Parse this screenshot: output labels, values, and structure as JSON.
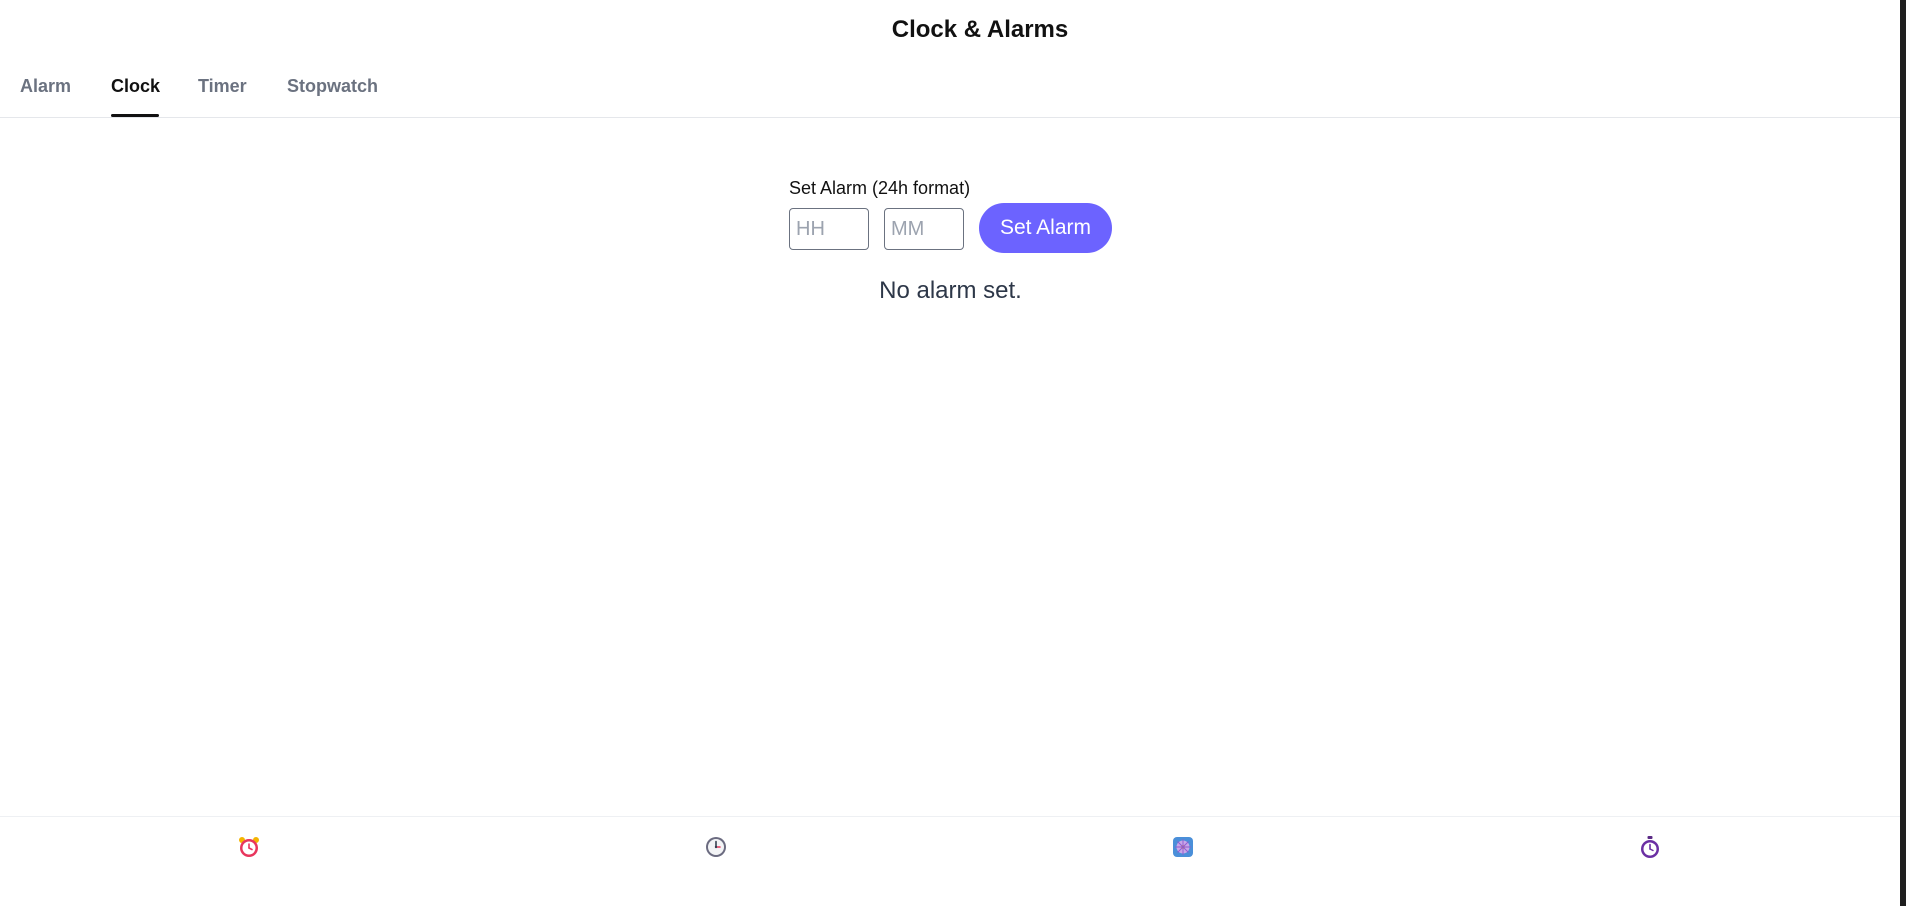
{
  "app": {
    "title": "Clock & Alarms"
  },
  "tabs": [
    {
      "label": "Alarm",
      "active": false
    },
    {
      "label": "Clock",
      "active": true
    },
    {
      "label": "Timer",
      "active": false
    },
    {
      "label": "Stopwatch",
      "active": false
    }
  ],
  "alarm_form": {
    "label": "Set Alarm (24h format)",
    "hour_placeholder": "HH",
    "minute_placeholder": "MM",
    "hour_value": "",
    "minute_value": "",
    "submit_label": "Set Alarm",
    "status_text": "No alarm set."
  },
  "bottom_nav": [
    {
      "icon": "alarm-clock-icon"
    },
    {
      "icon": "clock-icon"
    },
    {
      "icon": "globe-icon"
    },
    {
      "icon": "stopwatch-icon"
    }
  ],
  "colors": {
    "accent": "#6c63ff",
    "active_tab": "#111111",
    "inactive_tab": "#6b7280",
    "status_text": "#2d3748"
  }
}
